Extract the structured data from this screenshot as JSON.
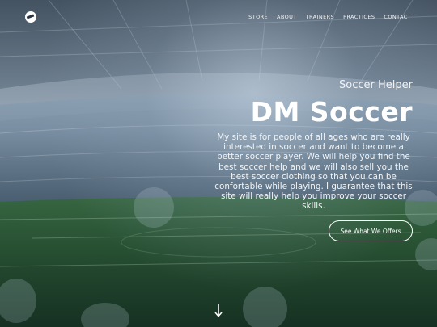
{
  "nav": {
    "logo": "soccer-ball-icon",
    "items": [
      "STORE",
      "ABOUT",
      "TRAINERS",
      "PRACTICES",
      "CONTACT"
    ]
  },
  "hero": {
    "subtitle": "Soccer Helper",
    "title": "DM Soccer",
    "description": "My site is for people of all ages who are really interested in soccer and want to become a better soccer player. We will help you find the best soccer help and we will also sell you the best soccer clothing so that you can be confortable while playing. I guarantee that this site will really help you improve your soccer skills.",
    "cta_label": "See What We Offers"
  },
  "scroll_indicator": "arrow-down-icon",
  "colors": {
    "text": "#ffffff",
    "field_green": "#2f5a3a",
    "sky": "#6f8295"
  }
}
